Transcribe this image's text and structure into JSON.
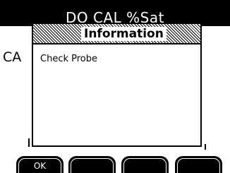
{
  "screen": {
    "title": "DO CAL %Sat",
    "background_label": "CA"
  },
  "dialog": {
    "title": "Information",
    "message": "Check Probe"
  },
  "softkeys": [
    {
      "label": "OK"
    },
    {
      "label": ""
    },
    {
      "label": ""
    },
    {
      "label": ""
    }
  ],
  "colors": {
    "foreground": "#000000",
    "background": "#ffffff"
  }
}
